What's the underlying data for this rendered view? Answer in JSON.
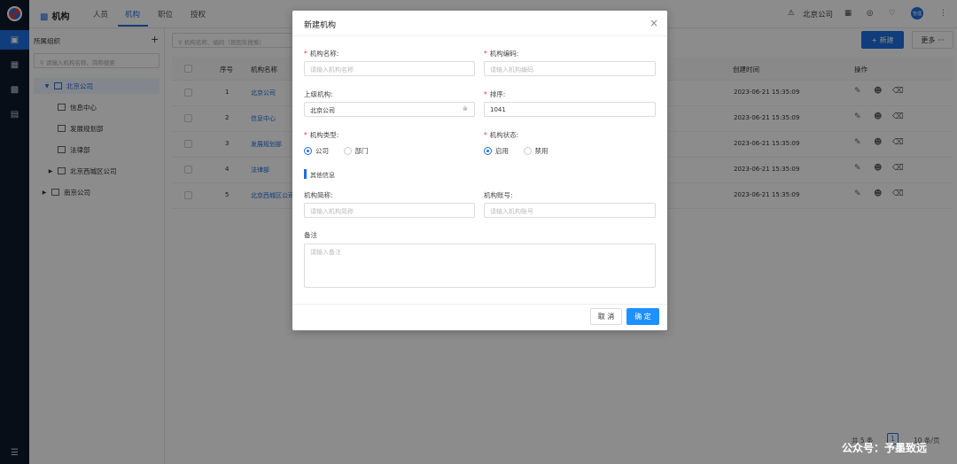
{
  "app": {
    "module_title": "机构",
    "tabs": [
      "人员",
      "机构",
      "职位",
      "授权"
    ],
    "active_tab": "机构",
    "company": "北京公司",
    "avatar_text": "管理"
  },
  "left_panel": {
    "title": "所属组织",
    "add_symbol": "+",
    "search_placeholder": "请输入机构名称、简称搜索",
    "tree": [
      {
        "label": "北京公司",
        "selected": true,
        "expanded": true
      },
      {
        "label": "信息中心"
      },
      {
        "label": "发展规划部"
      },
      {
        "label": "法律部"
      },
      {
        "label": "北京西城区公司",
        "collapsed": true
      },
      {
        "label": "南京公司",
        "collapsed": true
      }
    ]
  },
  "main": {
    "search_placeholder": "机构名称、编码（按回车搜索）",
    "new_button": "+ 新建",
    "more_button": "更多 ···",
    "columns": {
      "index": "序号",
      "name": "机构名称",
      "created": "创建时间",
      "ops": "操作"
    },
    "rows": [
      {
        "index": "1",
        "name": "北京公司",
        "created": "2023-06-21 15:35:09"
      },
      {
        "index": "2",
        "name": "信息中心",
        "created": "2023-06-21 15:35:09"
      },
      {
        "index": "3",
        "name": "发展规划部",
        "created": "2023-06-21 15:35:09"
      },
      {
        "index": "4",
        "name": "法律部",
        "created": "2023-06-21 15:35:09"
      },
      {
        "index": "5",
        "name": "北京西城区公司",
        "created": "2023-06-21 15:35:09"
      }
    ],
    "pager": {
      "total": "共 5 条",
      "page": "1",
      "page_size": "10 条/页"
    }
  },
  "modal": {
    "title": "新建机构",
    "close": "×",
    "fields": {
      "name_label": "机构名称:",
      "name_placeholder": "请输入机构名称",
      "code_label": "机构编码:",
      "code_placeholder": "请输入机构编码",
      "parent_label": "上级机构:",
      "parent_value": "北京公司",
      "sort_label": "排序:",
      "sort_value": "1041",
      "type_label": "机构类型:",
      "type_options": [
        "公司",
        "部门"
      ],
      "type_selected": "公司",
      "status_label": "机构状态:",
      "status_options": [
        "启用",
        "禁用"
      ],
      "status_selected": "启用",
      "section_other": "其他信息",
      "short_label": "机构简称:",
      "short_placeholder": "请输入机构简称",
      "acct_label": "机构账号:",
      "acct_placeholder": "请输入机构账号",
      "remark_label": "备注",
      "remark_placeholder": "请输入备注"
    },
    "cancel": "取 消",
    "ok": "确 定"
  },
  "watermark": "公众号：予墨致远",
  "colors": {
    "primary": "#1e6fe0",
    "rail": "#0f1b2c",
    "required": "#e0403a"
  }
}
